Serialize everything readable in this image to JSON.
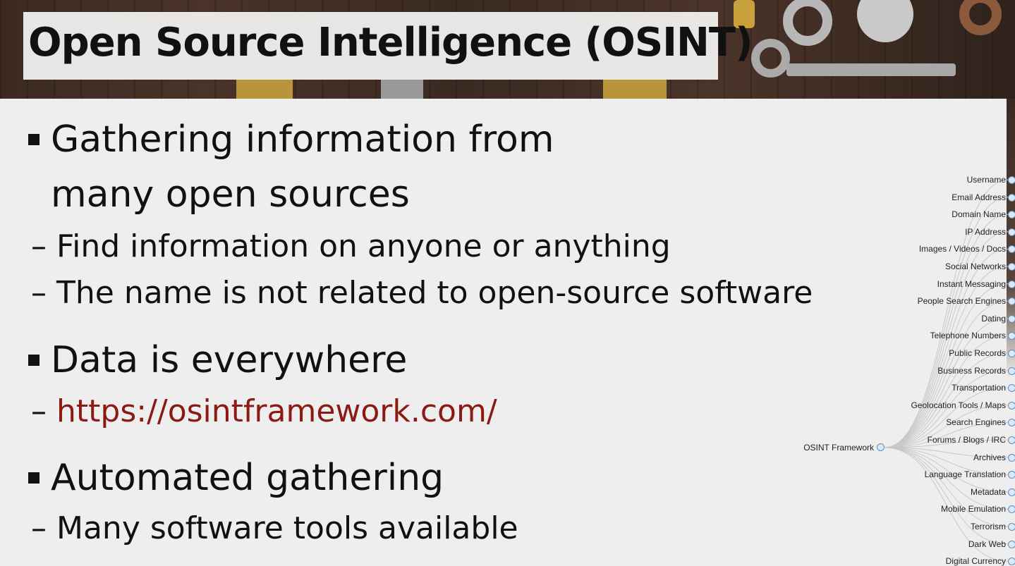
{
  "slide": {
    "title": "Open Source Intelligence (OSINT)",
    "bullets": [
      {
        "text": "Gathering information from",
        "continuation": "many open sources"
      },
      {
        "text": "Data is everywhere"
      },
      {
        "text": "Automated gathering"
      }
    ],
    "subbullets": {
      "b1_1": "Find information on anyone or anything",
      "b1_2": "The name is not related to open-source software",
      "b2_1": "https://osintframework.com/",
      "b3_1": "Many software tools available"
    },
    "link_color": "#8b1a12"
  },
  "framework_tree": {
    "root_label": "OSINT Framework",
    "branches": [
      "Username",
      "Email Address",
      "Domain Name",
      "IP Address",
      "Images / Videos / Docs",
      "Social Networks",
      "Instant Messaging",
      "People Search Engines",
      "Dating",
      "Telephone Numbers",
      "Public Records",
      "Business Records",
      "Transportation",
      "Geolocation Tools / Maps",
      "Search Engines",
      "Forums / Blogs / IRC",
      "Archives",
      "Language Translation",
      "Metadata",
      "Mobile Emulation",
      "Terrorism",
      "Dark Web",
      "Digital Currency"
    ],
    "node_color": "#5a8fc6"
  }
}
